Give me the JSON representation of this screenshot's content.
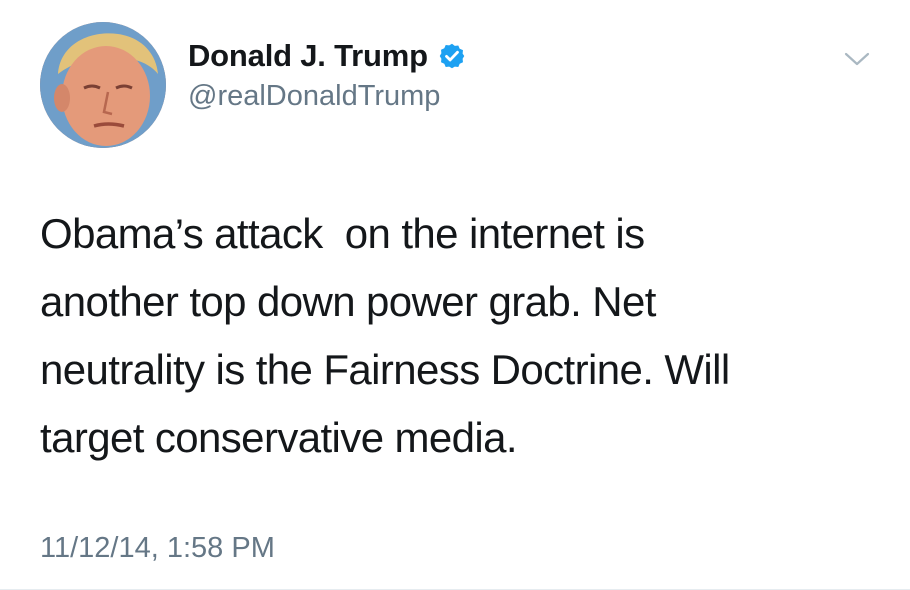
{
  "author": {
    "display_name": "Donald J. Trump",
    "handle": "@realDonaldTrump",
    "verified": true
  },
  "icons": {
    "verified": "verified-badge-icon",
    "menu": "chevron-down-icon",
    "avatar": "profile-photo"
  },
  "tweet": {
    "text": "Obama’s attack  on the internet is another top down power grab. Net neutrality is the Fairness Doctrine. Will target conservative media.",
    "line_1": "Obama’s attack  on the internet is",
    "line_2": "another top down power grab. Net",
    "line_3": "neutrality is the Fairness Doctrine. Will",
    "line_4": "target conservative media.",
    "timestamp": "11/12/14, 1:58 PM"
  },
  "colors": {
    "text_primary": "#14171a",
    "text_secondary": "#657786",
    "verified_blue": "#1da1f2",
    "chevron": "#aab8c2",
    "background": "#ffffff"
  }
}
